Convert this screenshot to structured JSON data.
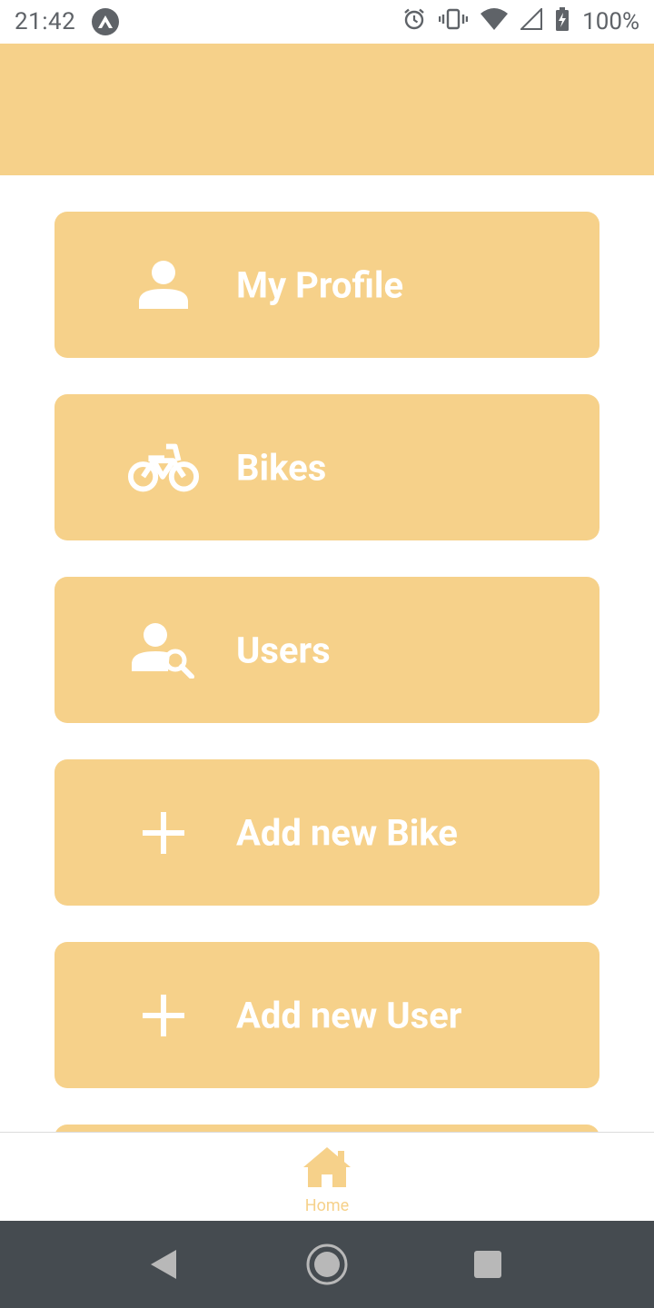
{
  "status_bar": {
    "time": "21:42",
    "battery": "100%",
    "icons": [
      "expo-icon",
      "alarm-icon",
      "vibrate-icon",
      "wifi-icon",
      "signal-icon",
      "battery-charging-icon"
    ]
  },
  "menu": {
    "items": [
      {
        "label": "My Profile",
        "icon": "person-icon"
      },
      {
        "label": "Bikes",
        "icon": "bike-icon"
      },
      {
        "label": "Users",
        "icon": "user-search-icon"
      },
      {
        "label": "Add new Bike",
        "icon": "plus-icon"
      },
      {
        "label": "Add new User",
        "icon": "plus-icon"
      }
    ]
  },
  "tab_bar": {
    "home_label": "Home"
  },
  "colors": {
    "accent": "#f6d18a",
    "nav_bar": "#454b50",
    "text_on_accent": "#ffffff"
  }
}
